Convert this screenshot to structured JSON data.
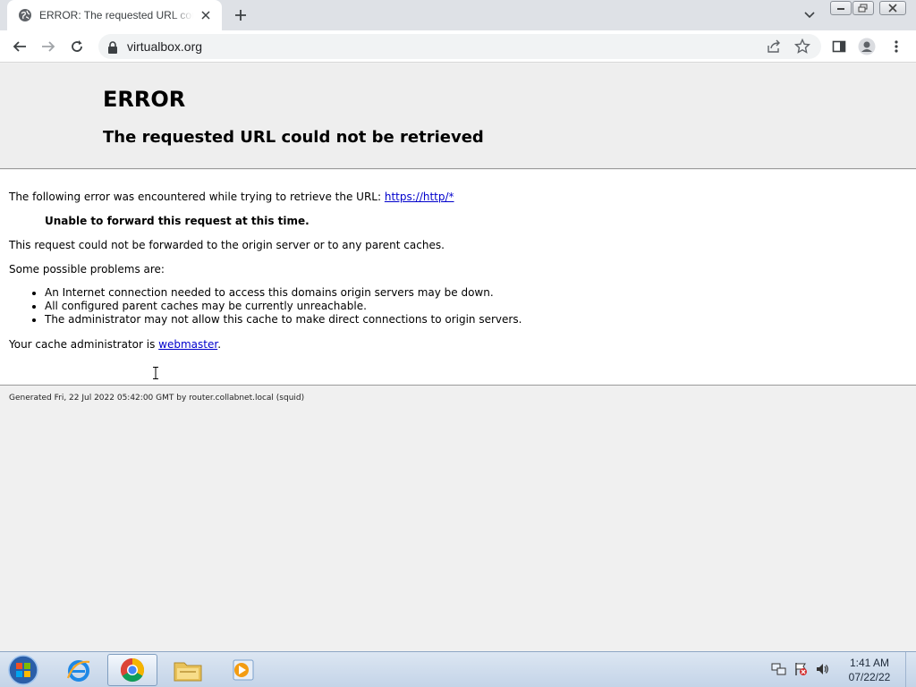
{
  "browser": {
    "tab_title": "ERROR: The requested URL could not be retrieved",
    "address": "virtualbox.org"
  },
  "page": {
    "heading": "ERROR",
    "subheading": "The requested URL could not be retrieved",
    "intro_text": "The following error was encountered while trying to retrieve the URL: ",
    "intro_link": "https://http/*",
    "error_message": "Unable to forward this request at this time.",
    "detail": "This request could not be forwarded to the origin server or to any parent caches.",
    "problems_intro": "Some possible problems are:",
    "problems": [
      "An Internet connection needed to access this domains origin servers may be down.",
      "All configured parent caches may be currently unreachable.",
      "The administrator may not allow this cache to make direct connections to origin servers."
    ],
    "admin_text": "Your cache administrator is ",
    "admin_link": "webmaster",
    "admin_suffix": ".",
    "footer": "Generated Fri, 22 Jul 2022 05:42:00 GMT by router.collabnet.local (squid)"
  },
  "taskbar": {
    "time": "1:41 AM",
    "date": "07/22/22",
    "apps": [
      "internet-explorer",
      "chrome",
      "windows-explorer",
      "media-player"
    ]
  },
  "colors": {
    "link": "#0000cc",
    "header_bg": "#eeeeee",
    "body_bg": "#ffffff",
    "taskbar": "#c4d4e8"
  }
}
